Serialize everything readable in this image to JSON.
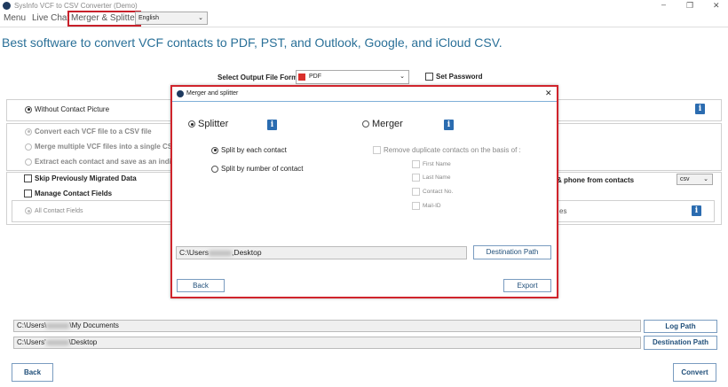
{
  "window": {
    "title": "SysInfo VCF to CSV Converter (Demo)",
    "minimize": "–",
    "restore": "❐",
    "close": "✕"
  },
  "menu": {
    "items": [
      "Menu",
      "Live Chat",
      "Merger & Splitter"
    ],
    "language": "English"
  },
  "headline": "Best software to convert VCF contacts to PDF, PST, and Outlook, Google, and iCloud CSV.",
  "format": {
    "label": "Select Output File Format:",
    "value": "PDF",
    "set_password": "Set Password"
  },
  "options": {
    "without_picture": "Without Contact Picture",
    "radios": [
      "Convert each VCF file to a CSV file",
      "Merge multiple VCF files into a single CSV file",
      "Extract each contact and save as an individual"
    ],
    "skip": "Skip Previously Migrated Data",
    "manage": "Manage Contact Fields",
    "all_fields": "All Contact Fields",
    "phone_text": "& phone from contacts",
    "csv_select": "csv",
    "es_text": "es"
  },
  "dialog": {
    "title": "Merger and splitter",
    "close": "✕",
    "splitter": "Splitter",
    "merger": "Merger",
    "split_each": "Split by each contact",
    "split_number": "Split by number of contact",
    "remove_dup": "Remove duplicate contacts on the basis of :",
    "fields": [
      "First Name",
      "Last Name",
      "Contact No.",
      "Mail-ID"
    ],
    "path_prefix": "C:\\Users",
    "path_suffix": ",Desktop",
    "dest_button": "Destination Path",
    "back": "Back",
    "export": "Export"
  },
  "bottom": {
    "log_prefix": "C:\\Users\\",
    "log_suffix": "\\My Documents",
    "log_button": "Log Path",
    "dest_prefix": "C:\\Users'",
    "dest_suffix": "\\Desktop",
    "dest_button": "Destination Path",
    "back": "Back",
    "convert": "Convert"
  }
}
